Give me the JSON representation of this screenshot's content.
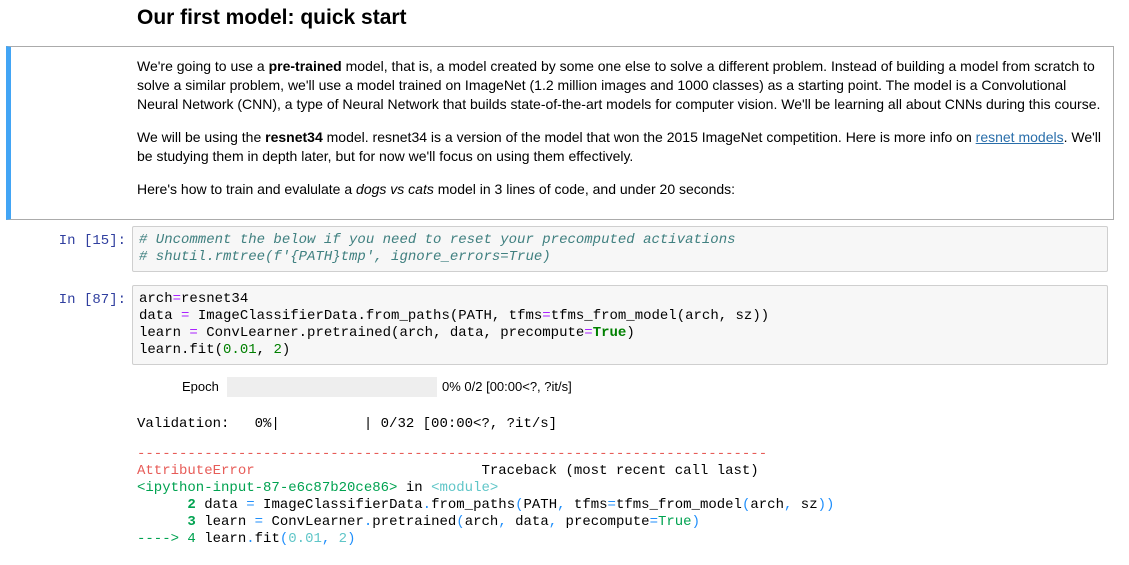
{
  "heading": "Our first model: quick start",
  "markdown": {
    "p1": {
      "t1": "We're going to use a ",
      "b1": "pre-trained",
      "t2": " model, that is, a model created by some one else to solve a different problem. Instead of building a model from scratch to solve a similar problem, we'll use a model trained on ImageNet (1.2 million images and 1000 classes) as a starting point. The model is a Convolutional Neural Network (CNN), a type of Neural Network that builds state-of-the-art models for computer vision. We'll be learning all about CNNs during this course."
    },
    "p2": {
      "t1": "We will be using the ",
      "b1": "resnet34",
      "t2": " model. resnet34 is a version of the model that won the 2015 ImageNet competition. Here is more info on ",
      "link": "resnet models",
      "t3": ". We'll be studying them in depth later, but for now we'll focus on using them effectively."
    },
    "p3": {
      "t1": "Here's how to train and evalulate a ",
      "i1": "dogs vs cats",
      "t2": " model in 3 lines of code, and under 20 seconds:"
    }
  },
  "cell1": {
    "prompt": "In [15]:",
    "line1": "# Uncomment the below if you need to reset your precomputed activations",
    "line2": "# shutil.rmtree(f'{PATH}tmp', ignore_errors=True)"
  },
  "cell2": {
    "prompt": "In [87]:",
    "l1a": "arch",
    "l1b": "=",
    "l1c": "resnet34",
    "l2a": "data ",
    "l2b": "=",
    "l2c": " ImageClassifierData.from_paths(PATH, tfms",
    "l2d": "=",
    "l2e": "tfms_from_model(arch, sz))",
    "l3a": "learn ",
    "l3b": "=",
    "l3c": " ConvLearner.pretrained(arch, data, precompute",
    "l3d": "=",
    "l3e": "True",
    "l3f": ")",
    "l4a": "learn.fit(",
    "l4b": "0.01",
    "l4c": ", ",
    "l4d": "2",
    "l4e": ")"
  },
  "progress": {
    "label": "Epoch",
    "value": 0,
    "text": "0% 0/2 [00:00<?, ?it/s]"
  },
  "validation": "Validation:   0%|          | 0/32 [00:00<?, ?it/s]",
  "traceback": {
    "dashes": "---------------------------------------------------------------------------",
    "error_name": "AttributeError",
    "header_right": "                           Traceback (most recent call last)",
    "input_ref": "<ipython-input-87-e6c87b20ce86>",
    "in_word": " in ",
    "module": "<module>",
    "l2_num": "      2 ",
    "l2_a": "data ",
    "l2_b": "=",
    "l2_c": " ImageClassifierData",
    "l2_d": ".",
    "l2_e": "from_paths",
    "l2_f": "(",
    "l2_g": "PATH",
    "l2_h": ",",
    "l2_i": " tfms",
    "l2_j": "=",
    "l2_k": "tfms_from_model",
    "l2_l": "(",
    "l2_m": "arch",
    "l2_n": ",",
    "l2_o": " sz",
    "l2_p": "))",
    "l3_num": "      3 ",
    "l3_a": "learn ",
    "l3_b": "=",
    "l3_c": " ConvLearner",
    "l3_d": ".",
    "l3_e": "pretrained",
    "l3_f": "(",
    "l3_g": "arch",
    "l3_h": ",",
    "l3_i": " data",
    "l3_j": ",",
    "l3_k": " precompute",
    "l3_l": "=",
    "l3_m": "True",
    "l3_n": ")",
    "l4_arrow": "----> 4 ",
    "l4_a": "learn",
    "l4_b": ".",
    "l4_c": "fit",
    "l4_d": "(",
    "l4_e": "0.01",
    "l4_f": ",",
    "l4_g": " 2",
    "l4_h": ")"
  },
  "colors": {
    "prompt": "#303f9f",
    "markdown_border": "#42a5f5",
    "error_red": "#e75c58",
    "green": "#00a250"
  }
}
